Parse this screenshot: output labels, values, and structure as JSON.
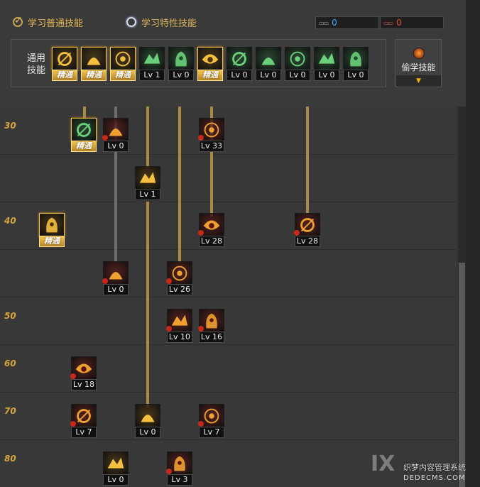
{
  "tabs": [
    {
      "label": "学习普通技能",
      "active": true
    },
    {
      "label": "学习特性技能",
      "active": false
    }
  ],
  "counters": [
    {
      "icon": "skill-book-blue-icon",
      "value": "0",
      "color": "#3fa7ff"
    },
    {
      "icon": "skill-book-red-icon",
      "value": "0",
      "color": "#e0502a"
    }
  ],
  "general": {
    "label_line1": "通用",
    "label_line2": "技能",
    "skills": [
      {
        "icon": "runner-icon",
        "level": "精通",
        "mastered": true
      },
      {
        "icon": "sprint-icon",
        "level": "精通",
        "mastered": true
      },
      {
        "icon": "dash-icon",
        "level": "精通",
        "mastered": true
      },
      {
        "icon": "wings-icon",
        "level": "Lv 1",
        "mastered": false
      },
      {
        "icon": "target-icon",
        "level": "Lv 0",
        "mastered": false
      },
      {
        "icon": "target-burst-icon",
        "level": "精通",
        "mastered": true
      },
      {
        "icon": "leap-icon",
        "level": "Lv 0",
        "mastered": false
      },
      {
        "icon": "gear-figure-icon",
        "level": "Lv 0",
        "mastered": false
      },
      {
        "icon": "eye-icon",
        "level": "Lv 0",
        "mastered": false
      },
      {
        "icon": "power-figure-icon",
        "level": "Lv 0",
        "mastered": false
      },
      {
        "icon": "shield-figure-icon",
        "level": "Lv 0",
        "mastered": false
      }
    ]
  },
  "steal": {
    "label": "偷学技能",
    "icon": "fire-orb-icon",
    "arrow": "▼"
  },
  "tree": {
    "levels": [
      "30",
      "40",
      "50",
      "60",
      "70",
      "80"
    ],
    "nodes": [
      {
        "icon": "net-icon",
        "level": "精通",
        "mastered": true,
        "theme": "green",
        "badge": false
      },
      {
        "icon": "cloud-burst-icon",
        "level": "Lv 0",
        "mastered": false,
        "theme": "red",
        "badge": true
      },
      {
        "icon": "pumpkin-icon",
        "level": "Lv 33",
        "mastered": false,
        "theme": "red",
        "badge": true
      },
      {
        "icon": "swirl-icon",
        "level": "Lv 1",
        "mastered": false,
        "theme": "gold",
        "badge": false
      },
      {
        "icon": "claw-strike-icon",
        "level": "精通",
        "mastered": true,
        "theme": "gold",
        "badge": false
      },
      {
        "icon": "sack-icon",
        "level": "Lv 28",
        "mastered": false,
        "theme": "red",
        "badge": true
      },
      {
        "icon": "arc-slash-icon",
        "level": "Lv 28",
        "mastered": false,
        "theme": "red",
        "badge": true
      },
      {
        "icon": "wind-slash-icon",
        "level": "Lv 0",
        "mastered": false,
        "theme": "red",
        "badge": true
      },
      {
        "icon": "fighter-icon",
        "level": "Lv 26",
        "mastered": false,
        "theme": "red",
        "badge": true
      },
      {
        "icon": "demon-mask-icon",
        "level": "Lv 10",
        "mastered": false,
        "theme": "red",
        "badge": true
      },
      {
        "icon": "skull-swarm-icon",
        "level": "Lv 16",
        "mastered": false,
        "theme": "red",
        "badge": true
      },
      {
        "icon": "pineapple-icon",
        "level": "Lv 18",
        "mastered": false,
        "theme": "red",
        "badge": true
      },
      {
        "icon": "bug-emblem-icon",
        "level": "Lv 7",
        "mastered": false,
        "theme": "red",
        "badge": true
      },
      {
        "icon": "lion-icon",
        "level": "Lv 0",
        "mastered": false,
        "theme": "gold",
        "badge": false
      },
      {
        "icon": "goblin-pair-icon",
        "level": "Lv 7",
        "mastered": false,
        "theme": "red",
        "badge": true
      },
      {
        "icon": "golden-eye-icon",
        "level": "Lv 0",
        "mastered": false,
        "theme": "gold",
        "badge": false
      },
      {
        "icon": "crosshair-ring-icon",
        "level": "Lv 3",
        "mastered": false,
        "theme": "red",
        "badge": true
      }
    ]
  },
  "watermark": {
    "text": "织梦内容管理系统",
    "site": "DEDECMS.COM"
  }
}
